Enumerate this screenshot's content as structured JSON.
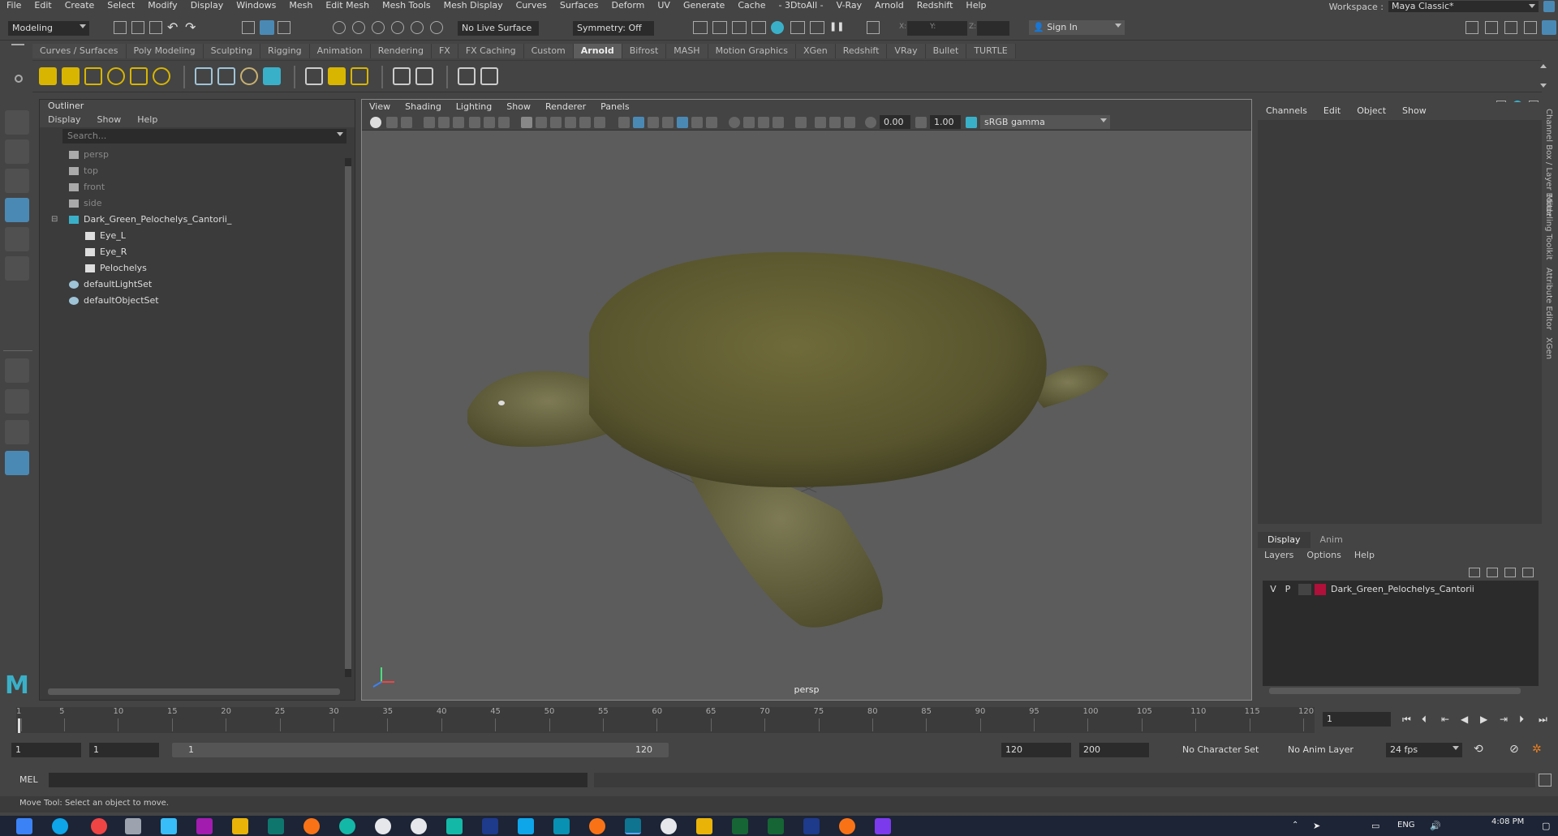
{
  "menubar": {
    "items": [
      "File",
      "Edit",
      "Create",
      "Select",
      "Modify",
      "Display",
      "Windows",
      "Mesh",
      "Edit Mesh",
      "Mesh Tools",
      "Mesh Display",
      "Curves",
      "Surfaces",
      "Deform",
      "UV",
      "Generate",
      "Cache",
      "- 3DtoAll -",
      "V-Ray",
      "Arnold",
      "Redshift",
      "Help"
    ],
    "workspace_label": "Workspace :",
    "workspace_value": "Maya Classic*"
  },
  "statusline": {
    "mode": "Modeling",
    "live_surface": "No Live Surface",
    "symmetry": "Symmetry: Off",
    "x_label": "X:",
    "y_label": "Y:",
    "z_label": "Z:",
    "sign_in": "Sign In"
  },
  "shelf": {
    "tabs": [
      "Curves / Surfaces",
      "Poly Modeling",
      "Sculpting",
      "Rigging",
      "Animation",
      "Rendering",
      "FX",
      "FX Caching",
      "Custom",
      "Arnold",
      "Bifrost",
      "MASH",
      "Motion Graphics",
      "XGen",
      "Redshift",
      "VRay",
      "Bullet",
      "TURTLE"
    ],
    "active": "Arnold"
  },
  "outliner": {
    "title": "Outliner",
    "menu": [
      "Display",
      "Show",
      "Help"
    ],
    "search_placeholder": "Search...",
    "items": [
      {
        "label": "persp",
        "dim": true,
        "type": "camera",
        "indent": 0
      },
      {
        "label": "top",
        "dim": true,
        "type": "camera",
        "indent": 0
      },
      {
        "label": "front",
        "dim": true,
        "type": "camera",
        "indent": 0
      },
      {
        "label": "side",
        "dim": true,
        "type": "camera",
        "indent": 0
      },
      {
        "label": "Dark_Green_Pelochelys_Cantorii_",
        "dim": false,
        "type": "group",
        "indent": 0
      },
      {
        "label": "Eye_L",
        "dim": false,
        "type": "mesh",
        "indent": 1
      },
      {
        "label": "Eye_R",
        "dim": false,
        "type": "mesh",
        "indent": 1
      },
      {
        "label": "Pelochelys",
        "dim": false,
        "type": "mesh",
        "indent": 1
      },
      {
        "label": "defaultLightSet",
        "dim": false,
        "type": "set",
        "indent": 0
      },
      {
        "label": "defaultObjectSet",
        "dim": false,
        "type": "set",
        "indent": 0
      }
    ]
  },
  "viewport": {
    "menu": [
      "View",
      "Shading",
      "Lighting",
      "Show",
      "Renderer",
      "Panels"
    ],
    "exposure": "0.00",
    "gamma": "1.00",
    "color_space": "sRGB gamma",
    "camera": "persp"
  },
  "channelbox": {
    "menu": [
      "Channels",
      "Edit",
      "Object",
      "Show"
    ]
  },
  "layers": {
    "tabs": [
      "Display",
      "Anim"
    ],
    "menu": [
      "Layers",
      "Options",
      "Help"
    ],
    "rows": [
      {
        "v": "V",
        "p": "P",
        "name": "Dark_Green_Pelochelys_Cantorii",
        "color": "#b0103a"
      }
    ]
  },
  "sidetabs": [
    "Channel Box / Layer Editor",
    "Modeling Toolkit",
    "Attribute Editor",
    "XGen"
  ],
  "timeslider": {
    "ticks": [
      "1",
      "5",
      "10",
      "15",
      "20",
      "25",
      "30",
      "35",
      "40",
      "45",
      "50",
      "55",
      "60",
      "65",
      "70",
      "75",
      "80",
      "85",
      "90",
      "95",
      "100",
      "105",
      "110",
      "115",
      "120"
    ],
    "current_frame": "1"
  },
  "range": {
    "start": "1",
    "playback_start": "1",
    "slider_start": "1",
    "slider_end": "120",
    "playback_end": "120",
    "end": "200",
    "character_set": "No Character Set",
    "anim_layer": "No Anim Layer",
    "fps": "24 fps"
  },
  "cmdline": {
    "label": "MEL"
  },
  "helpline": {
    "text": "Move Tool: Select an object to move."
  },
  "taskbar": {
    "lang": "ENG",
    "time": "4:08 PM"
  }
}
